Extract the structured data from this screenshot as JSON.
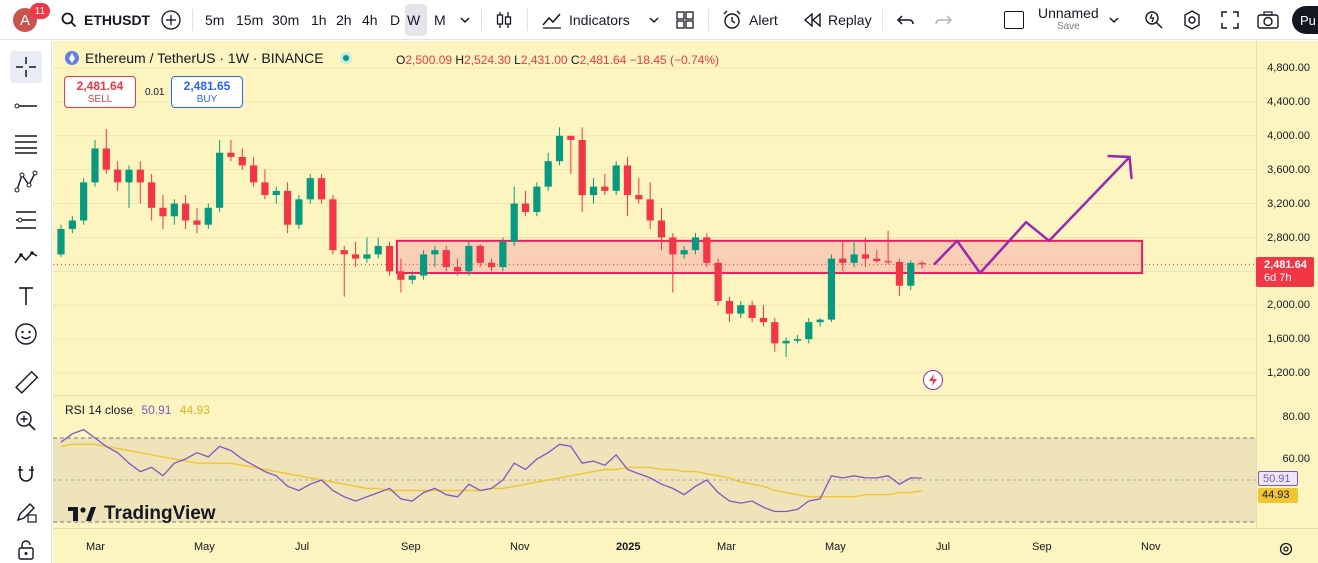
{
  "header": {
    "avatar_letter": "A",
    "notifications": "11",
    "symbol": "ETHUSDT",
    "timeframes": [
      "5m",
      "15m",
      "30m",
      "1h",
      "2h",
      "4h",
      "D",
      "W",
      "M"
    ],
    "active_timeframe": "W",
    "indicators_label": "Indicators",
    "alert_label": "Alert",
    "replay_label": "Replay",
    "layout_name": "Unnamed",
    "save_label": "Save",
    "publish_label": "Pu"
  },
  "legend": {
    "title": "Ethereum / TetherUS · 1W · BINANCE",
    "open_label": "O",
    "open": "2,500.09",
    "high_label": "H",
    "high": "2,524.30",
    "low_label": "L",
    "low": "2,431.00",
    "close_label": "C",
    "close": "2,481.64",
    "change": "−18.45 (−0.74%)"
  },
  "trade": {
    "sell_price": "2,481.64",
    "sell_label": "SELL",
    "spread": "0.01",
    "buy_price": "2,481.65",
    "buy_label": "BUY"
  },
  "price_axis": {
    "labels": [
      "4,800.00",
      "4,400.00",
      "4,000.00",
      "3,600.00",
      "3,200.00",
      "2,800.00",
      "2,000.00",
      "1,600.00",
      "1,200.00"
    ],
    "current_price": "2,481.64",
    "countdown": "6d 7h"
  },
  "rsi": {
    "title": "RSI 14 close",
    "value": "50.91",
    "ma_value": "44.93",
    "axis_labels": [
      "80.00",
      "60.00"
    ]
  },
  "time_axis": {
    "labels": [
      "Mar",
      "May",
      "Jul",
      "Sep",
      "Nov",
      "2025",
      "Mar",
      "May",
      "Jul",
      "Sep",
      "Nov"
    ]
  },
  "branding": {
    "logo_text": "TradingView"
  },
  "colors": {
    "up": "#089981",
    "down": "#f23645",
    "chart_bg": "#fdf5c0",
    "zone_fill": "#f7c6b3",
    "zone_border": "#e91e63",
    "projection": "#9c27b0",
    "rsi_line": "#7e57c2",
    "rsi_ma": "#f2c530"
  },
  "chart_data": {
    "type": "candlestick",
    "interval": "1W",
    "period": "Feb 2024 – Jun 2025",
    "ylim": [
      1200,
      4800
    ],
    "candles": [
      {
        "o": 2600,
        "h": 2950,
        "l": 2570,
        "c": 2900
      },
      {
        "o": 2900,
        "h": 3050,
        "l": 2850,
        "c": 3000
      },
      {
        "o": 3000,
        "h": 3500,
        "l": 2950,
        "c": 3450
      },
      {
        "o": 3450,
        "h": 3950,
        "l": 3400,
        "c": 3850
      },
      {
        "o": 3850,
        "h": 4080,
        "l": 3550,
        "c": 3600
      },
      {
        "o": 3600,
        "h": 3700,
        "l": 3350,
        "c": 3450
      },
      {
        "o": 3450,
        "h": 3650,
        "l": 3150,
        "c": 3600
      },
      {
        "o": 3600,
        "h": 3700,
        "l": 3200,
        "c": 3450
      },
      {
        "o": 3450,
        "h": 3550,
        "l": 3000,
        "c": 3150
      },
      {
        "o": 3150,
        "h": 3300,
        "l": 2900,
        "c": 3050
      },
      {
        "o": 3050,
        "h": 3250,
        "l": 2950,
        "c": 3200
      },
      {
        "o": 3200,
        "h": 3300,
        "l": 2900,
        "c": 3000
      },
      {
        "o": 3000,
        "h": 3150,
        "l": 2850,
        "c": 2950
      },
      {
        "o": 2950,
        "h": 3200,
        "l": 2900,
        "c": 3150
      },
      {
        "o": 3150,
        "h": 3950,
        "l": 3100,
        "c": 3800
      },
      {
        "o": 3800,
        "h": 3950,
        "l": 3700,
        "c": 3750
      },
      {
        "o": 3750,
        "h": 3850,
        "l": 3600,
        "c": 3650
      },
      {
        "o": 3650,
        "h": 3750,
        "l": 3400,
        "c": 3450
      },
      {
        "o": 3450,
        "h": 3600,
        "l": 3250,
        "c": 3300
      },
      {
        "o": 3300,
        "h": 3400,
        "l": 3200,
        "c": 3350
      },
      {
        "o": 3350,
        "h": 3450,
        "l": 2850,
        "c": 2950
      },
      {
        "o": 2950,
        "h": 3300,
        "l": 2900,
        "c": 3250
      },
      {
        "o": 3250,
        "h": 3550,
        "l": 3200,
        "c": 3500
      },
      {
        "o": 3500,
        "h": 3550,
        "l": 3200,
        "c": 3250
      },
      {
        "o": 3250,
        "h": 3300,
        "l": 2600,
        "c": 2650
      },
      {
        "o": 2650,
        "h": 2700,
        "l": 2100,
        "c": 2600
      },
      {
        "o": 2600,
        "h": 2750,
        "l": 2450,
        "c": 2550
      },
      {
        "o": 2550,
        "h": 2800,
        "l": 2500,
        "c": 2600
      },
      {
        "o": 2600,
        "h": 2800,
        "l": 2550,
        "c": 2700
      },
      {
        "o": 2700,
        "h": 2750,
        "l": 2350,
        "c": 2400
      },
      {
        "o": 2400,
        "h": 2550,
        "l": 2150,
        "c": 2300
      },
      {
        "o": 2300,
        "h": 2400,
        "l": 2250,
        "c": 2350
      },
      {
        "o": 2350,
        "h": 2650,
        "l": 2300,
        "c": 2600
      },
      {
        "o": 2600,
        "h": 2700,
        "l": 2450,
        "c": 2650
      },
      {
        "o": 2650,
        "h": 2700,
        "l": 2400,
        "c": 2450
      },
      {
        "o": 2450,
        "h": 2550,
        "l": 2350,
        "c": 2400
      },
      {
        "o": 2400,
        "h": 2750,
        "l": 2350,
        "c": 2700
      },
      {
        "o": 2700,
        "h": 2720,
        "l": 2450,
        "c": 2500
      },
      {
        "o": 2500,
        "h": 2550,
        "l": 2400,
        "c": 2450
      },
      {
        "o": 2450,
        "h": 2800,
        "l": 2400,
        "c": 2750
      },
      {
        "o": 2750,
        "h": 3400,
        "l": 2700,
        "c": 3200
      },
      {
        "o": 3200,
        "h": 3350,
        "l": 3050,
        "c": 3100
      },
      {
        "o": 3100,
        "h": 3450,
        "l": 3050,
        "c": 3400
      },
      {
        "o": 3400,
        "h": 3800,
        "l": 3350,
        "c": 3700
      },
      {
        "o": 3700,
        "h": 4100,
        "l": 3650,
        "c": 4000
      },
      {
        "o": 4000,
        "h": 4000,
        "l": 3550,
        "c": 3950
      },
      {
        "o": 3950,
        "h": 4100,
        "l": 3100,
        "c": 3300
      },
      {
        "o": 3300,
        "h": 3500,
        "l": 3200,
        "c": 3400
      },
      {
        "o": 3400,
        "h": 3550,
        "l": 3300,
        "c": 3350
      },
      {
        "o": 3350,
        "h": 3700,
        "l": 3300,
        "c": 3650
      },
      {
        "o": 3650,
        "h": 3750,
        "l": 3050,
        "c": 3300
      },
      {
        "o": 3300,
        "h": 3500,
        "l": 3200,
        "c": 3250
      },
      {
        "o": 3250,
        "h": 3450,
        "l": 2900,
        "c": 3000
      },
      {
        "o": 3000,
        "h": 3150,
        "l": 2650,
        "c": 2800
      },
      {
        "o": 2800,
        "h": 2850,
        "l": 2150,
        "c": 2600
      },
      {
        "o": 2600,
        "h": 2700,
        "l": 2550,
        "c": 2650
      },
      {
        "o": 2650,
        "h": 2850,
        "l": 2600,
        "c": 2800
      },
      {
        "o": 2800,
        "h": 2850,
        "l": 2450,
        "c": 2500
      },
      {
        "o": 2500,
        "h": 2550,
        "l": 2000,
        "c": 2050
      },
      {
        "o": 2050,
        "h": 2100,
        "l": 1800,
        "c": 1900
      },
      {
        "o": 1900,
        "h": 2050,
        "l": 1850,
        "c": 2000
      },
      {
        "o": 2000,
        "h": 2050,
        "l": 1800,
        "c": 1850
      },
      {
        "o": 1850,
        "h": 2000,
        "l": 1750,
        "c": 1800
      },
      {
        "o": 1800,
        "h": 1850,
        "l": 1450,
        "c": 1550
      },
      {
        "o": 1550,
        "h": 1620,
        "l": 1390,
        "c": 1580
      },
      {
        "o": 1580,
        "h": 1650,
        "l": 1550,
        "c": 1600
      },
      {
        "o": 1600,
        "h": 1850,
        "l": 1550,
        "c": 1800
      },
      {
        "o": 1800,
        "h": 1850,
        "l": 1750,
        "c": 1830
      },
      {
        "o": 1830,
        "h": 2600,
        "l": 1800,
        "c": 2550
      },
      {
        "o": 2550,
        "h": 2750,
        "l": 2400,
        "c": 2500
      },
      {
        "o": 2500,
        "h": 2750,
        "l": 2450,
        "c": 2600
      },
      {
        "o": 2600,
        "h": 2800,
        "l": 2450,
        "c": 2550
      },
      {
        "o": 2550,
        "h": 2650,
        "l": 2500,
        "c": 2520
      },
      {
        "o": 2520,
        "h": 2880,
        "l": 2480,
        "c": 2510
      },
      {
        "o": 2510,
        "h": 2550,
        "l": 2110,
        "c": 2230
      },
      {
        "o": 2230,
        "h": 2530,
        "l": 2180,
        "c": 2500
      },
      {
        "o": 2500,
        "h": 2524.3,
        "l": 2431,
        "c": 2481.64
      }
    ],
    "zone": {
      "from_price": 2380,
      "to_price": 2760
    },
    "projection_path": [
      [
        2481,
        0
      ],
      [
        2760,
        2
      ],
      [
        2380,
        4
      ],
      [
        2980,
        8
      ],
      [
        2760,
        10
      ],
      [
        3750,
        17
      ]
    ],
    "rsi_values": [
      68,
      72,
      74,
      70,
      66,
      63,
      58,
      54,
      56,
      52,
      58,
      60,
      63,
      61,
      66,
      64,
      60,
      57,
      54,
      52,
      47,
      45,
      48,
      50,
      45,
      42,
      40,
      42,
      44,
      46,
      41,
      40,
      44,
      46,
      43,
      42,
      48,
      45,
      46,
      50,
      58,
      55,
      60,
      63,
      67,
      66,
      58,
      59,
      57,
      62,
      55,
      53,
      51,
      48,
      46,
      43,
      47,
      50,
      44,
      40,
      39,
      40,
      37,
      35,
      35,
      36,
      40,
      41,
      52,
      51,
      52,
      51,
      51,
      52,
      48,
      51,
      50.91
    ],
    "rsi_ma_values": [
      66,
      67,
      67,
      67,
      66,
      65,
      64,
      63,
      62,
      61,
      60,
      59,
      58,
      58,
      58,
      58,
      57,
      56,
      55,
      54,
      53,
      52,
      51,
      50,
      49,
      48,
      47,
      46,
      46,
      45,
      45,
      45,
      45,
      45,
      45,
      45,
      45,
      45,
      46,
      46,
      47,
      48,
      49,
      50,
      51,
      52,
      53,
      54,
      55,
      55,
      56,
      56,
      56,
      55,
      55,
      54,
      54,
      53,
      52,
      51,
      49,
      48,
      47,
      45,
      44,
      43,
      42,
      42,
      42,
      42,
      42,
      43,
      43,
      43,
      44,
      44,
      44.93
    ]
  }
}
